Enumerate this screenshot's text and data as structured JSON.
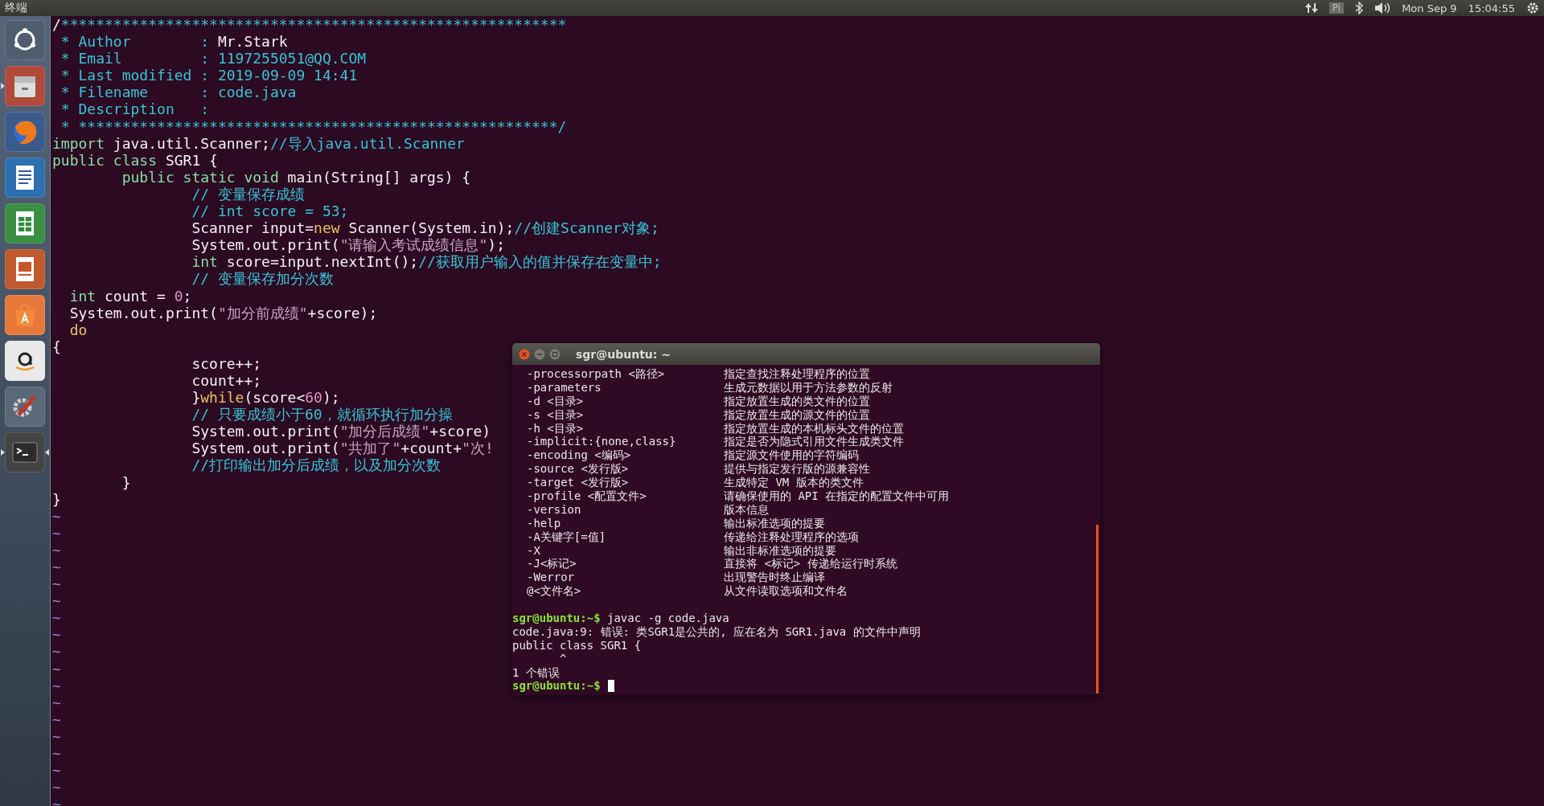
{
  "top_bar": {
    "app_title": "终端",
    "keyboard": "Pi",
    "date": "Mon Sep  9",
    "time": "15:04:55"
  },
  "launcher": {
    "items": [
      {
        "kind": "dash",
        "running": false,
        "focused": false
      },
      {
        "kind": "files",
        "running": true,
        "focused": false
      },
      {
        "kind": "browser",
        "running": false,
        "focused": false
      },
      {
        "kind": "writer",
        "running": false,
        "focused": false
      },
      {
        "kind": "calc",
        "running": false,
        "focused": false
      },
      {
        "kind": "impress",
        "running": false,
        "focused": false
      },
      {
        "kind": "software",
        "running": false,
        "focused": false
      },
      {
        "kind": "amazon",
        "running": false,
        "focused": false
      },
      {
        "kind": "settings",
        "running": false,
        "focused": false
      },
      {
        "kind": "terminal",
        "running": true,
        "focused": true
      }
    ]
  },
  "editor": {
    "lines": [
      [
        {
          "text": "/",
          "kind": "plain"
        },
        {
          "text": "**********************************************************",
          "kind": "comment"
        }
      ],
      [
        {
          "text": " * Author        : ",
          "kind": "comment"
        },
        {
          "text": "Mr.Stark",
          "kind": "plain"
        }
      ],
      [
        {
          "text": " * Email         : 1197255051@QQ.COM",
          "kind": "comment"
        }
      ],
      [
        {
          "text": " * Last modified : 2019-09-09 14:41",
          "kind": "comment"
        }
      ],
      [
        {
          "text": " * Filename      : code.java",
          "kind": "comment"
        }
      ],
      [
        {
          "text": " * Description   :",
          "kind": "comment"
        }
      ],
      [
        {
          "text": " * *******************************************************/",
          "kind": "comment"
        }
      ],
      [
        {
          "text": "import",
          "kind": "keyword"
        },
        {
          "text": " java.util.Scanner;",
          "kind": "plain"
        },
        {
          "text": "//导入java.util.Scanner",
          "kind": "comment"
        }
      ],
      [
        {
          "text": "public class",
          "kind": "keyword"
        },
        {
          "text": " SGR1 {",
          "kind": "plain"
        }
      ],
      [
        {
          "text": "        public static void",
          "kind": "keyword"
        },
        {
          "text": " main(String[] args) {",
          "kind": "plain"
        }
      ],
      [
        {
          "text": "                // 变量保存成绩",
          "kind": "comment"
        }
      ],
      [
        {
          "text": "                // int score = 53;",
          "kind": "comment"
        }
      ],
      [
        {
          "text": "                Scanner input=",
          "kind": "plain"
        },
        {
          "text": "new",
          "kind": "statement"
        },
        {
          "text": " Scanner(System.in);",
          "kind": "plain"
        },
        {
          "text": "//创建Scanner对象;",
          "kind": "comment"
        }
      ],
      [
        {
          "text": "                System.out.print(",
          "kind": "plain"
        },
        {
          "text": "\"请输入考试成绩信息\"",
          "kind": "string"
        },
        {
          "text": ");",
          "kind": "plain"
        }
      ],
      [
        {
          "text": "                int",
          "kind": "keyword"
        },
        {
          "text": " score=input.nextInt();",
          "kind": "plain"
        },
        {
          "text": "//获取用户输入的值并保存在变量中;",
          "kind": "comment"
        }
      ],
      [
        {
          "text": "                // 变量保存加分次数",
          "kind": "comment"
        }
      ],
      [
        {
          "text": "  int",
          "kind": "keyword"
        },
        {
          "text": " count = ",
          "kind": "plain"
        },
        {
          "text": "0",
          "kind": "number"
        },
        {
          "text": ";",
          "kind": "plain"
        }
      ],
      [
        {
          "text": "  System.out.print(",
          "kind": "plain"
        },
        {
          "text": "\"加分前成绩\"",
          "kind": "string"
        },
        {
          "text": "+score);",
          "kind": "plain"
        }
      ],
      [
        {
          "text": "  do",
          "kind": "statement"
        }
      ],
      [
        {
          "text": "{",
          "kind": "plain"
        }
      ],
      [
        {
          "text": "                score++;",
          "kind": "plain"
        }
      ],
      [
        {
          "text": "                count++;",
          "kind": "plain"
        }
      ],
      [
        {
          "text": "                }",
          "kind": "plain"
        },
        {
          "text": "while",
          "kind": "statement"
        },
        {
          "text": "(score<",
          "kind": "plain"
        },
        {
          "text": "60",
          "kind": "number"
        },
        {
          "text": ");",
          "kind": "plain"
        }
      ],
      [
        {
          "text": "                // 只要成绩小于60，就循环执行加分操",
          "kind": "comment"
        }
      ],
      [
        {
          "text": "                System.out.print(",
          "kind": "plain"
        },
        {
          "text": "\"加分后成绩\"",
          "kind": "string"
        },
        {
          "text": "+score)",
          "kind": "plain"
        }
      ],
      [
        {
          "text": "                System.out.print(",
          "kind": "plain"
        },
        {
          "text": "\"共加了\"",
          "kind": "string"
        },
        {
          "text": "+count+",
          "kind": "plain"
        },
        {
          "text": "\"次!",
          "kind": "string"
        }
      ],
      [
        {
          "text": "                //打印输出加分后成绩，以及加分次数",
          "kind": "comment"
        }
      ],
      [
        {
          "text": "        }",
          "kind": "plain"
        }
      ],
      [
        {
          "text": "}",
          "kind": "plain"
        }
      ]
    ],
    "tildes": [
      "~",
      "~",
      "~",
      "~",
      "~",
      "~",
      "~",
      "~",
      "~",
      "~",
      "~",
      "~",
      "~",
      "~",
      "~",
      "~",
      "~",
      "~"
    ]
  },
  "terminal": {
    "title": "sgr@ubuntu: ~",
    "options": [
      {
        "option": "-processorpath <路径>",
        "description": "指定查找注释处理程序的位置"
      },
      {
        "option": "-parameters",
        "description": "生成元数据以用于方法参数的反射"
      },
      {
        "option": "-d <目录>",
        "description": "指定放置生成的类文件的位置"
      },
      {
        "option": "-s <目录>",
        "description": "指定放置生成的源文件的位置"
      },
      {
        "option": "-h <目录>",
        "description": "指定放置生成的本机标头文件的位置"
      },
      {
        "option": "-implicit:{none,class}",
        "description": "指定是否为隐式引用文件生成类文件"
      },
      {
        "option": "-encoding <编码>",
        "description": "指定源文件使用的字符编码"
      },
      {
        "option": "-source <发行版>",
        "description": "提供与指定发行版的源兼容性"
      },
      {
        "option": "-target <发行版>",
        "description": "生成特定 VM 版本的类文件"
      },
      {
        "option": "-profile <配置文件>",
        "description": "请确保使用的 API 在指定的配置文件中可用"
      },
      {
        "option": "-version",
        "description": "版本信息"
      },
      {
        "option": "-help",
        "description": "输出标准选项的提要"
      },
      {
        "option": "-A关键字[=值]",
        "description": "传递给注释处理程序的选项"
      },
      {
        "option": "-X",
        "description": "输出非标准选项的提要"
      },
      {
        "option": "-J<标记>",
        "description": "直接将 <标记> 传递给运行时系统"
      },
      {
        "option": "-Werror",
        "description": "出现警告时终止编译"
      },
      {
        "option": "@<文件名>",
        "description": "从文件读取选项和文件名"
      }
    ],
    "session": [
      {
        "kind": "prompt",
        "prompt": "sgr@ubuntu:~$",
        "command": "javac -g code.java",
        "cursor": false
      },
      {
        "kind": "output",
        "text": "code.java:9: 错误: 类SGR1是公共的, 应在名为 SGR1.java 的文件中声明"
      },
      {
        "kind": "output",
        "text": "public class SGR1 {"
      },
      {
        "kind": "output",
        "text": "       ^"
      },
      {
        "kind": "output",
        "text": "1 个错误"
      },
      {
        "kind": "prompt",
        "prompt": "sgr@ubuntu:~$",
        "cursor": true
      }
    ]
  }
}
